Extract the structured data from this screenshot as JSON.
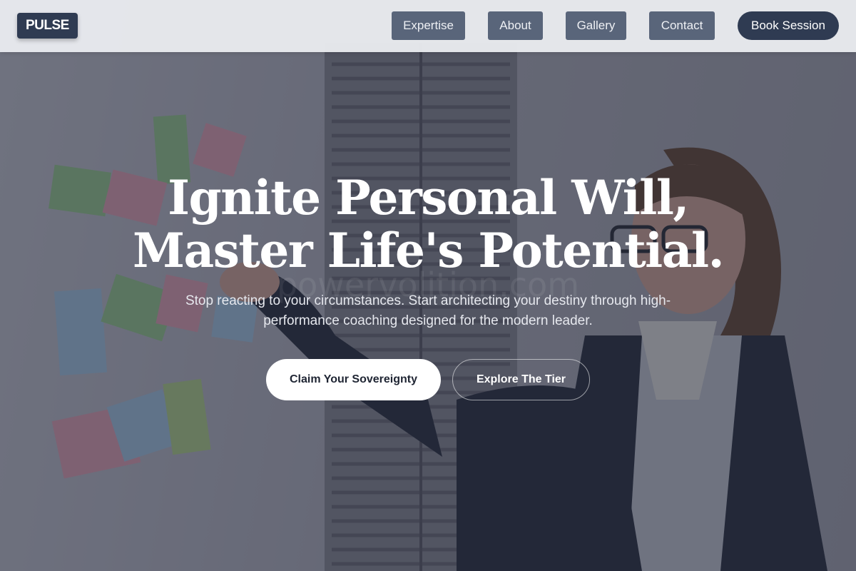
{
  "brand": {
    "logo_text": "PULSE"
  },
  "nav": {
    "items": [
      {
        "label": "Expertise"
      },
      {
        "label": "About"
      },
      {
        "label": "Gallery"
      },
      {
        "label": "Contact"
      }
    ],
    "cta_label": "Book Session"
  },
  "hero": {
    "title_line1": "Ignite Personal Will,",
    "title_line2": "Master Life's Potential.",
    "subtitle": "Stop reacting to your circumstances. Start architecting your destiny through high-performance coaching designed for the modern leader.",
    "primary_cta": "Claim Your Sovereignty",
    "secondary_cta": "Explore The Tier",
    "watermark_text": "powervolition.com",
    "background_image": "woman-pointing-at-sticky-notes-photo"
  },
  "colors": {
    "brand_dark": "#2f3b52",
    "nav_button": "#59657a",
    "header_bg": "#e8eaee",
    "overlay": "#1c2234"
  }
}
